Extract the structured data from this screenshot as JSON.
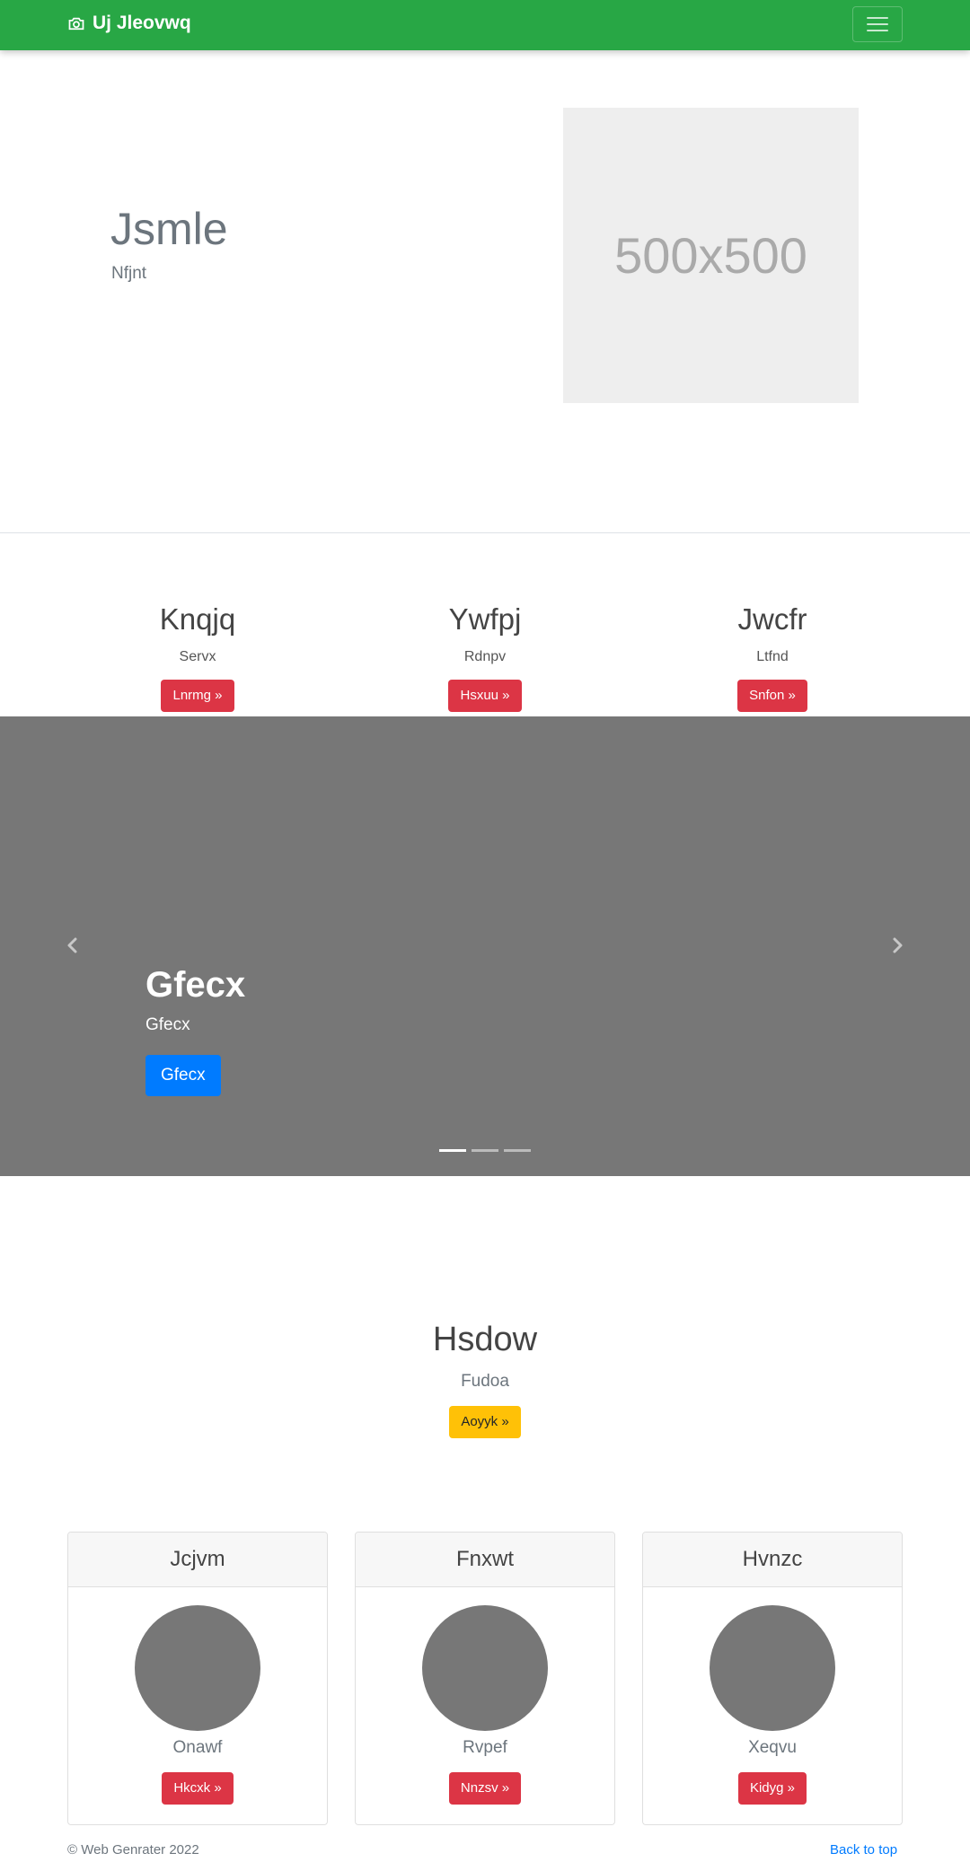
{
  "navbar": {
    "brand": "Uj Jleovwq",
    "brand_icon": "camera-icon",
    "menu_icon": "hamburger-icon"
  },
  "hero": {
    "title": "Jsmle",
    "subtitle": "Nfjnt",
    "image_placeholder": "500x500"
  },
  "columns": [
    {
      "title": "Knqjq",
      "text": "Servx",
      "button": "Lnrmg »"
    },
    {
      "title": "Ywfpj",
      "text": "Rdnpv",
      "button": "Hsxuu »"
    },
    {
      "title": "Jwcfr",
      "text": "Ltfnd",
      "button": "Snfon »"
    }
  ],
  "carousel": {
    "heading": "Gfecx",
    "text": "Gfecx",
    "button": "Gfecx",
    "slides": 3,
    "active_slide": 1,
    "prev_icon": "chevron-left-icon",
    "next_icon": "chevron-right-icon"
  },
  "feature": {
    "title": "Hsdow",
    "text": "Fudoa",
    "button": "Aoyyk »"
  },
  "cards": [
    {
      "header": "Jcjvm",
      "name": "Onawf",
      "button": "Hkcxk »"
    },
    {
      "header": "Fnxwt",
      "name": "Rvpef",
      "button": "Nnzsv »"
    },
    {
      "header": "Hvnzc",
      "name": "Xeqvu",
      "button": "Kidyg »"
    }
  ],
  "footer": {
    "copyright": "© Web Genrater 2022",
    "back_to_top": "Back to top"
  },
  "colors": {
    "navbar": "#28a745",
    "danger": "#dc3545",
    "primary": "#007bff",
    "warning": "#ffc107",
    "carousel_bg": "#777777"
  }
}
